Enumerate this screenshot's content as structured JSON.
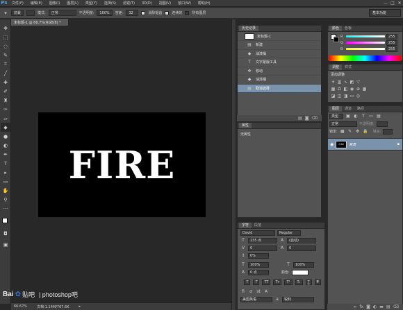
{
  "app": {
    "logo": "Ps"
  },
  "menubar": {
    "items": [
      "文件(F)",
      "编辑(E)",
      "图像(I)",
      "图层(L)",
      "类型(Y)",
      "选择(S)",
      "滤镜(T)",
      "3D(D)",
      "视图(V)",
      "窗口(W)",
      "帮助(H)"
    ],
    "window_controls": [
      "—",
      "□",
      "✕"
    ]
  },
  "options": {
    "tool_label": "前景",
    "mode_label": "模式:",
    "mode_value": "正常",
    "opacity_label": "不透明度:",
    "opacity_value": "100%",
    "tolerance_label": "容差:",
    "tolerance_value": "32",
    "antialias_label": "消除锯齿",
    "contiguous_label": "连续的",
    "all_layers_label": "所有图层",
    "workspace": "基本功能"
  },
  "document": {
    "tab_title": "未标题-1 @ 66.7%(RGB/8) *",
    "canvas_text": "FIRE",
    "zoom": "66.67%",
    "doc_info": "文档:1.14M/767.6K"
  },
  "history": {
    "tabs": [
      "历史记录"
    ],
    "snapshot": "未标题-1",
    "items": [
      {
        "label": "新建",
        "icon": "doc-icon"
      },
      {
        "label": "油漆桶",
        "icon": "bucket-icon"
      },
      {
        "label": "文字蒙版工具",
        "icon": "type-icon"
      },
      {
        "label": "移动",
        "icon": "move-icon"
      },
      {
        "label": "油漆桶",
        "icon": "bucket-icon"
      },
      {
        "label": "取消选择",
        "icon": "doc-icon"
      }
    ],
    "selected_index": 5
  },
  "properties": {
    "tab": "属性",
    "empty_text": "无属性"
  },
  "character": {
    "tabs": [
      "字符",
      "段落"
    ],
    "font_family": "David",
    "font_style": "Regular",
    "font_size": "235 点",
    "leading": "(自动)",
    "kerning": "0",
    "tracking": "0",
    "vertical_scale": "0%",
    "scale_v": "100%",
    "scale_h": "100%",
    "baseline": "0 点",
    "color_label": "颜色:",
    "language": "美国英语",
    "antialias": "锐利"
  },
  "color_panel": {
    "tabs": [
      "颜色",
      "色板"
    ],
    "r": "255",
    "g": "255",
    "b": "255",
    "r_label": "R",
    "g_label": "G",
    "b_label": "B"
  },
  "adjustments": {
    "tabs": [
      "调整",
      "样式"
    ],
    "title": "添加调整"
  },
  "layers": {
    "tabs": [
      "图层",
      "通道",
      "路径"
    ],
    "kind": "类型",
    "blend": "正常",
    "opacity_label": "不透明度:",
    "fill_label": "填充:",
    "lock_label": "锁定:",
    "layer_name": "背景",
    "thumb_text": "FIRE"
  },
  "watermark": {
    "brand": "Bai",
    "sub": "贴吧",
    "text": "| photoshop吧"
  },
  "colors": {
    "accent": "#3fa0ff",
    "selection": "#7a93ab",
    "panel": "#535353"
  }
}
